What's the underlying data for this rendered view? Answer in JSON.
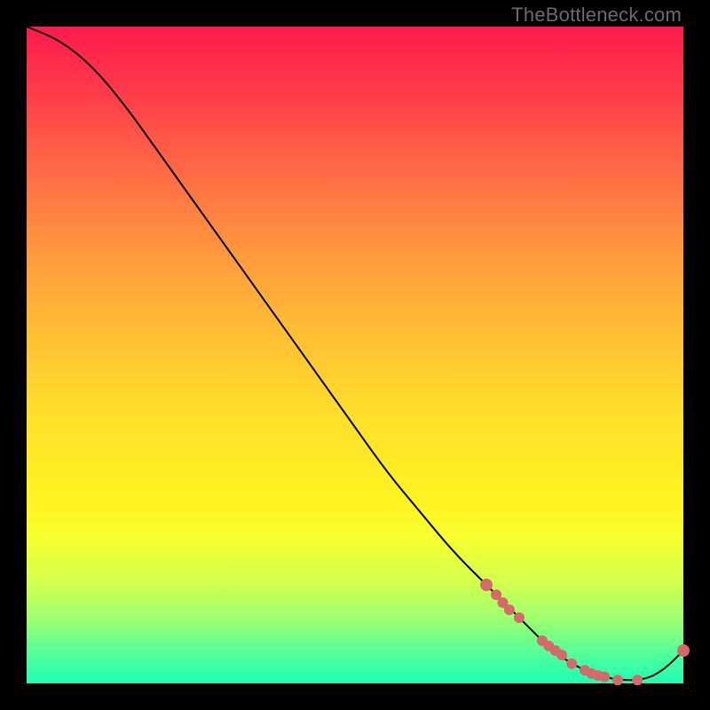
{
  "watermark": "TheBottleneck.com",
  "colors": {
    "dot": "#d46a6a",
    "curve": "#000000"
  },
  "chart_data": {
    "type": "line",
    "title": "",
    "xlabel": "",
    "ylabel": "",
    "xlim": [
      0,
      100
    ],
    "ylim": [
      0,
      100
    ],
    "curve": {
      "x": [
        0,
        5,
        10,
        15,
        20,
        25,
        30,
        35,
        40,
        45,
        50,
        55,
        60,
        65,
        70,
        75,
        78,
        80,
        83,
        86,
        90,
        94,
        97,
        100
      ],
      "y": [
        100,
        98,
        94,
        88,
        81,
        74,
        67,
        60,
        53,
        46,
        39,
        32,
        26,
        20,
        15,
        10,
        7,
        5,
        3,
        1.5,
        0.5,
        0.5,
        2,
        5
      ]
    },
    "dots": {
      "x": [
        70,
        71.5,
        72.5,
        73.5,
        75,
        78.5,
        79.5,
        80.5,
        81.5,
        83,
        85,
        86,
        87,
        88,
        90,
        93,
        100
      ],
      "y": [
        15,
        13.5,
        12.3,
        11.2,
        10,
        6.5,
        5.7,
        5.0,
        4.3,
        3,
        2,
        1.5,
        1.2,
        1.0,
        0.5,
        0.5,
        5
      ]
    }
  }
}
